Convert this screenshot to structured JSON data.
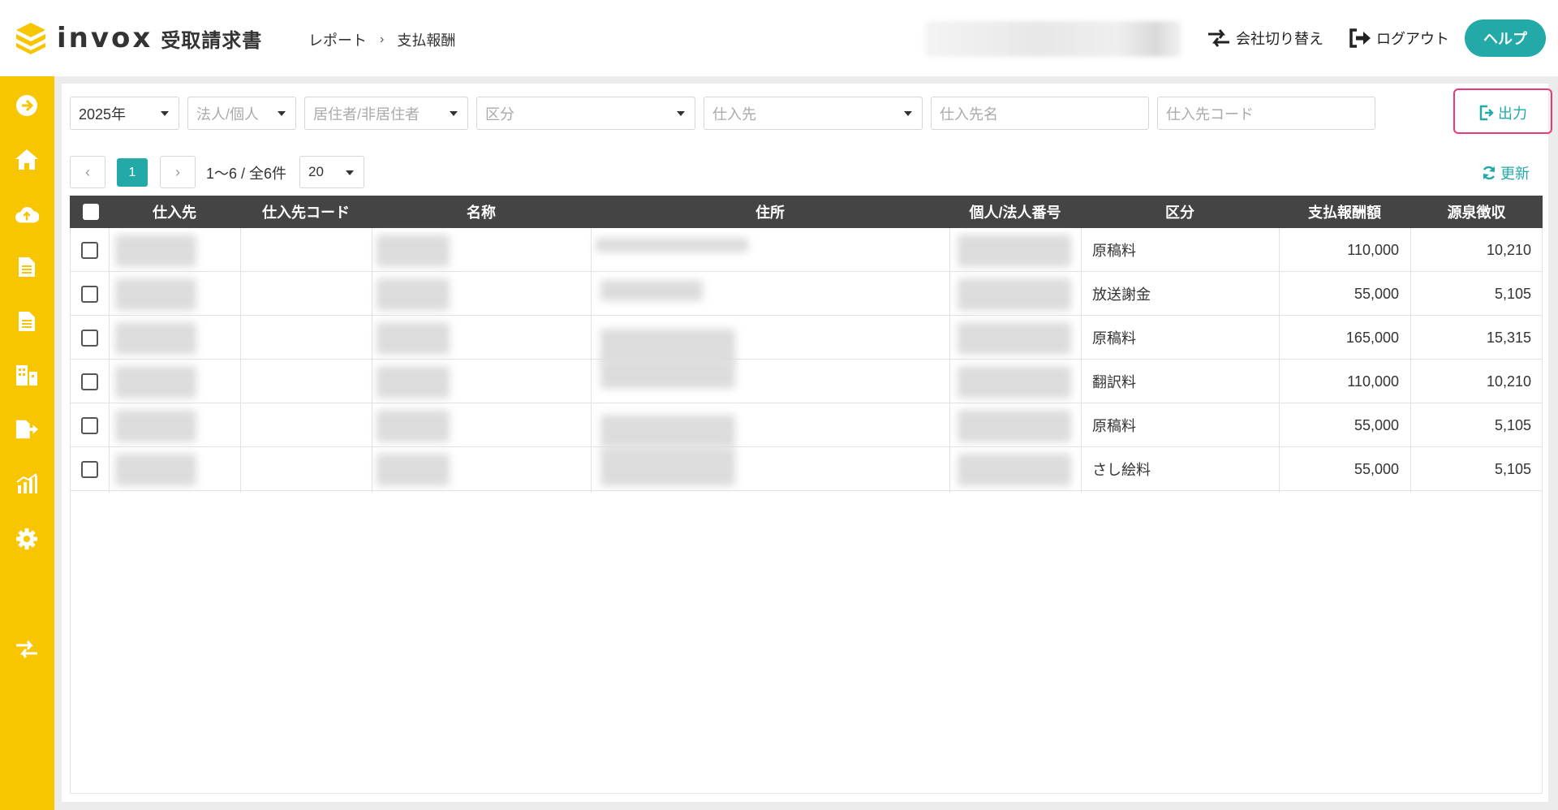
{
  "header": {
    "logo_text": "invox",
    "logo_sub": "受取請求書",
    "breadcrumb": [
      "レポート",
      "支払報酬"
    ],
    "breadcrumb_sep": "›",
    "switch_company": "会社切り替え",
    "logout": "ログアウト",
    "help": "ヘルプ"
  },
  "sidebar": {
    "items": [
      {
        "icon": "arrow-right-circle-icon"
      },
      {
        "icon": "home-icon"
      },
      {
        "icon": "cloud-upload-icon"
      },
      {
        "icon": "document-icon"
      },
      {
        "icon": "document-alt-icon"
      },
      {
        "icon": "building-icon"
      },
      {
        "icon": "file-export-icon"
      },
      {
        "icon": "chart-icon"
      },
      {
        "icon": "gear-icon"
      },
      {
        "icon": "switch-icon"
      }
    ]
  },
  "filters": {
    "year": "2025年",
    "type_placeholder": "法人/個人",
    "residency_placeholder": "居住者/非居住者",
    "category_placeholder": "区分",
    "supplier_placeholder": "仕入先",
    "supplier_name_placeholder": "仕入先名",
    "supplier_code_placeholder": "仕入先コード",
    "export_label": "出力"
  },
  "pagination": {
    "prev": "‹",
    "current_page": "1",
    "next": "›",
    "info": "1〜6 / 全6件",
    "per_page": "20",
    "refresh_label": "更新"
  },
  "table": {
    "columns": [
      "仕入先",
      "仕入先コード",
      "名称",
      "住所",
      "個人/法人番号",
      "区分",
      "支払報酬額",
      "源泉徴収"
    ],
    "rows": [
      {
        "category": "原稿料",
        "amount": "110,000",
        "withholding": "10,210"
      },
      {
        "category": "放送謝金",
        "amount": "55,000",
        "withholding": "5,105"
      },
      {
        "category": "原稿料",
        "amount": "165,000",
        "withholding": "15,315"
      },
      {
        "category": "翻訳料",
        "amount": "110,000",
        "withholding": "10,210"
      },
      {
        "category": "原稿料",
        "amount": "55,000",
        "withholding": "5,105"
      },
      {
        "category": "さし絵料",
        "amount": "55,000",
        "withholding": "5,105"
      }
    ]
  },
  "colors": {
    "sidebar": "#f7c600",
    "accent": "#23aaa8",
    "highlight": "#ea3a72",
    "table_header": "#444444"
  }
}
